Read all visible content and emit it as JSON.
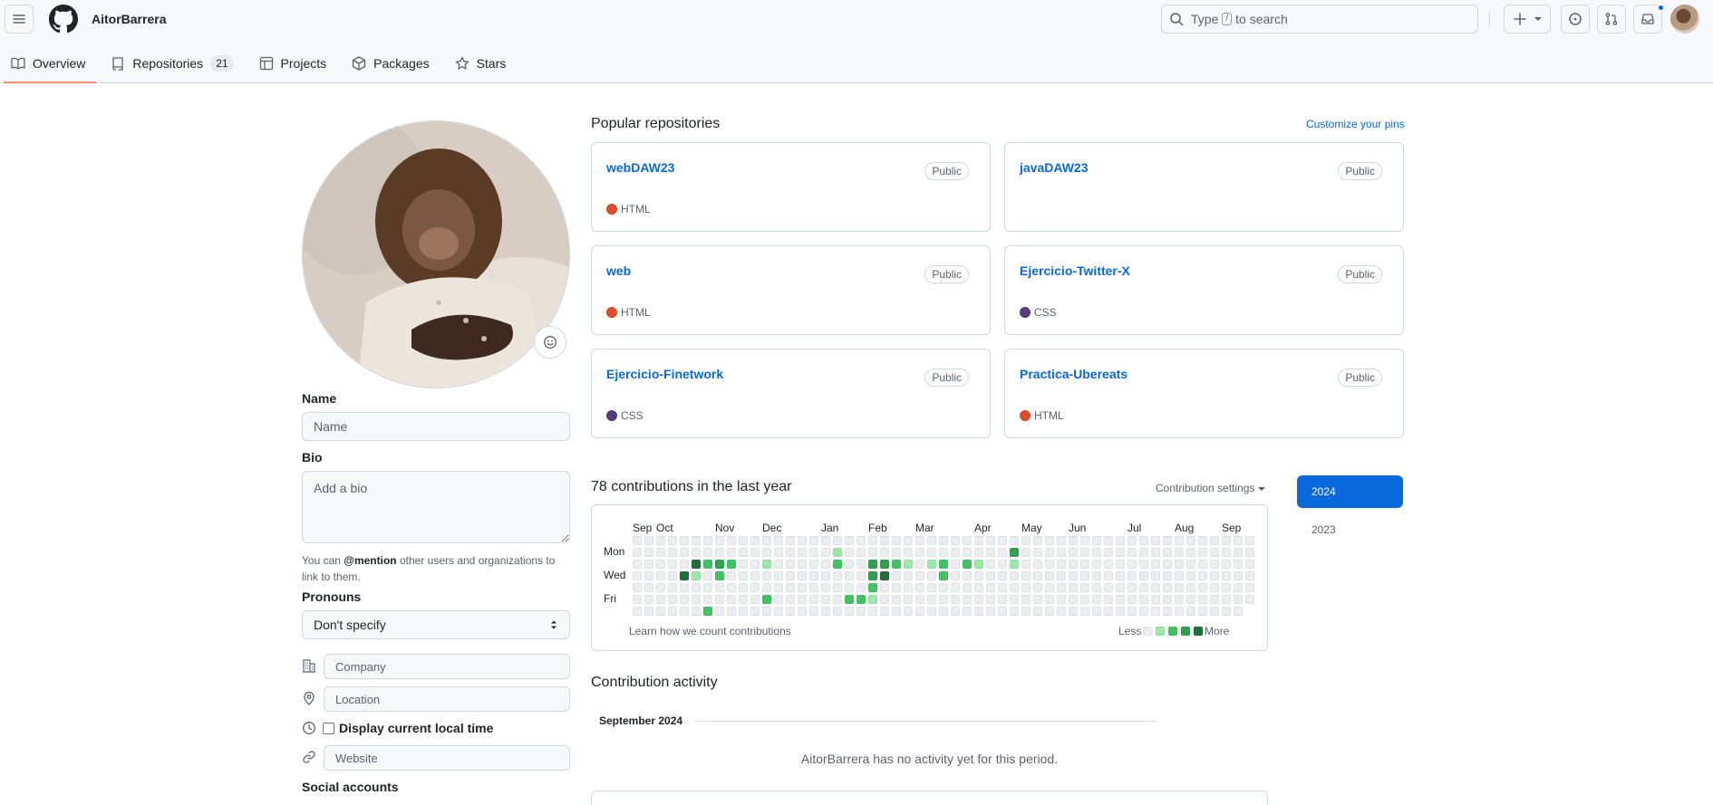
{
  "header": {
    "username": "AitorBarrera",
    "search": {
      "prefix": "Type",
      "key": "/",
      "suffix": "to search"
    },
    "notification_indicator": true
  },
  "tabs": [
    {
      "label": "Overview",
      "icon": "book-icon",
      "active": true
    },
    {
      "label": "Repositories",
      "icon": "repo-icon",
      "count": "21"
    },
    {
      "label": "Projects",
      "icon": "table-icon"
    },
    {
      "label": "Packages",
      "icon": "package-icon"
    },
    {
      "label": "Stars",
      "icon": "star-icon"
    }
  ],
  "profile": {
    "name_label": "Name",
    "name_placeholder": "Name",
    "bio_label": "Bio",
    "bio_placeholder": "Add a bio",
    "help_prefix": "You can ",
    "help_mention": "@mention",
    "help_suffix": " other users and organizations to link to them.",
    "pronouns_label": "Pronouns",
    "pronouns_value": "Don't specify",
    "company_placeholder": "Company",
    "location_placeholder": "Location",
    "local_time_label": "Display current local time",
    "website_placeholder": "Website",
    "social_label": "Social accounts"
  },
  "popular": {
    "title": "Popular repositories",
    "customize_label": "Customize your pins",
    "repos": [
      {
        "name": "webDAW23",
        "visibility": "Public",
        "language": "HTML",
        "lang_color": "#e34c26"
      },
      {
        "name": "javaDAW23",
        "visibility": "Public",
        "language": "",
        "lang_color": ""
      },
      {
        "name": "web",
        "visibility": "Public",
        "language": "HTML",
        "lang_color": "#e34c26"
      },
      {
        "name": "Ejercicio-Twitter-X",
        "visibility": "Public",
        "language": "CSS",
        "lang_color": "#563d7c"
      },
      {
        "name": "Ejercicio-Finetwork",
        "visibility": "Public",
        "language": "CSS",
        "lang_color": "#563d7c"
      },
      {
        "name": "Practica-Ubereats",
        "visibility": "Public",
        "language": "HTML",
        "lang_color": "#e34c26"
      }
    ]
  },
  "contributions": {
    "title": "78 contributions in the last year",
    "settings_label": "Contribution settings",
    "months": [
      "Sep",
      "Oct",
      "Nov",
      "Dec",
      "Jan",
      "Feb",
      "Mar",
      "Apr",
      "May",
      "Jun",
      "Jul",
      "Aug",
      "Sep"
    ],
    "days": [
      "Mon",
      "Wed",
      "Fri"
    ],
    "learn_label": "Learn how we count contributions",
    "less_label": "Less",
    "more_label": "More",
    "levels_colors": [
      "#ebedf0",
      "#9be9a8",
      "#40c463",
      "#30a14e",
      "#216e39"
    ],
    "active_cells": [
      {
        "w": 5,
        "d": 2,
        "l": 4
      },
      {
        "w": 5,
        "d": 3,
        "l": 1
      },
      {
        "w": 4,
        "d": 3,
        "l": 4
      },
      {
        "w": 6,
        "d": 2,
        "l": 2
      },
      {
        "w": 7,
        "d": 2,
        "l": 3
      },
      {
        "w": 7,
        "d": 3,
        "l": 2
      },
      {
        "w": 8,
        "d": 2,
        "l": 2
      },
      {
        "w": 6,
        "d": 6,
        "l": 2
      },
      {
        "w": 11,
        "d": 2,
        "l": 1
      },
      {
        "w": 11,
        "d": 5,
        "l": 2
      },
      {
        "w": 17,
        "d": 1,
        "l": 1
      },
      {
        "w": 17,
        "d": 2,
        "l": 2
      },
      {
        "w": 18,
        "d": 5,
        "l": 2
      },
      {
        "w": 19,
        "d": 5,
        "l": 2
      },
      {
        "w": 20,
        "d": 2,
        "l": 3
      },
      {
        "w": 20,
        "d": 3,
        "l": 3
      },
      {
        "w": 20,
        "d": 4,
        "l": 2
      },
      {
        "w": 20,
        "d": 5,
        "l": 1
      },
      {
        "w": 21,
        "d": 2,
        "l": 3
      },
      {
        "w": 21,
        "d": 3,
        "l": 4
      },
      {
        "w": 22,
        "d": 2,
        "l": 2
      },
      {
        "w": 23,
        "d": 2,
        "l": 1
      },
      {
        "w": 25,
        "d": 2,
        "l": 1
      },
      {
        "w": 26,
        "d": 2,
        "l": 2
      },
      {
        "w": 26,
        "d": 3,
        "l": 2
      },
      {
        "w": 28,
        "d": 2,
        "l": 2
      },
      {
        "w": 29,
        "d": 2,
        "l": 1
      },
      {
        "w": 32,
        "d": 1,
        "l": 3
      },
      {
        "w": 32,
        "d": 2,
        "l": 1
      }
    ]
  },
  "years": {
    "active": "2024",
    "other": "2023"
  },
  "activity": {
    "title": "Contribution activity",
    "period": "September 2024",
    "empty_message": "AitorBarrera has no activity yet for this period."
  }
}
